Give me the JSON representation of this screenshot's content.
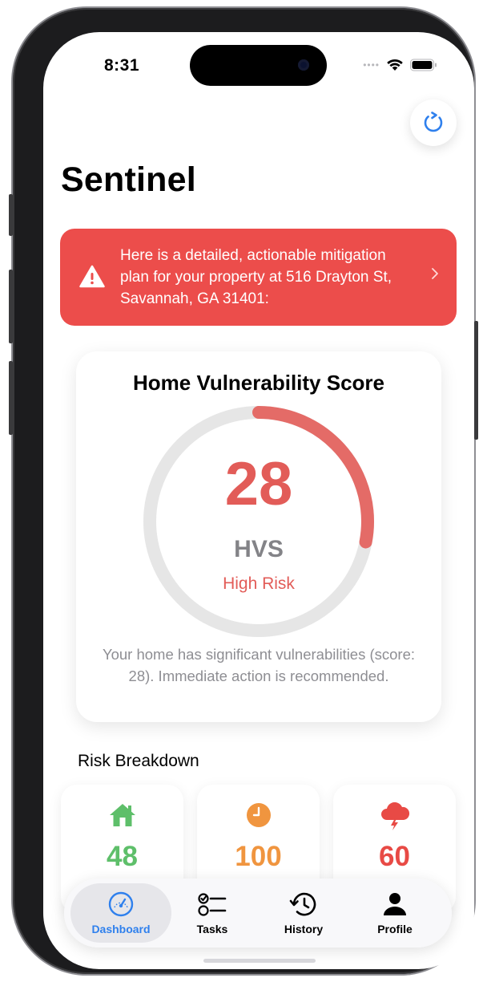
{
  "status_bar": {
    "time": "8:31"
  },
  "app": {
    "title": "Sentinel"
  },
  "alert": {
    "text": "Here is a detailed, actionable mitigation plan for your property at 516 Drayton St, Savannah, GA 31401:"
  },
  "score_card": {
    "title": "Home Vulnerability Score",
    "score": "28",
    "unit": "HVS",
    "risk_label": "High Risk",
    "gauge_fraction": 0.28,
    "description": "Your home has significant vulnerabilities (score: 28). Immediate action is recommended."
  },
  "breakdown": {
    "label": "Risk Breakdown",
    "items": [
      {
        "icon": "house-icon",
        "value": "48",
        "color": "#5ebf6a"
      },
      {
        "icon": "clock-icon",
        "value": "100",
        "color": "#f0953f"
      },
      {
        "icon": "storm-cloud-icon",
        "value": "60",
        "color": "#e84a45"
      }
    ]
  },
  "tabbar": {
    "tabs": [
      {
        "label": "Dashboard",
        "icon": "gauge-icon",
        "active": true
      },
      {
        "label": "Tasks",
        "icon": "checklist-icon",
        "active": false
      },
      {
        "label": "History",
        "icon": "history-icon",
        "active": false
      },
      {
        "label": "Profile",
        "icon": "person-icon",
        "active": false
      }
    ]
  },
  "colors": {
    "alert_bg": "#ec4d4b",
    "risk_red": "#e25c58",
    "accent_blue": "#2f80ed",
    "gauge_track": "#e6e6e6"
  }
}
